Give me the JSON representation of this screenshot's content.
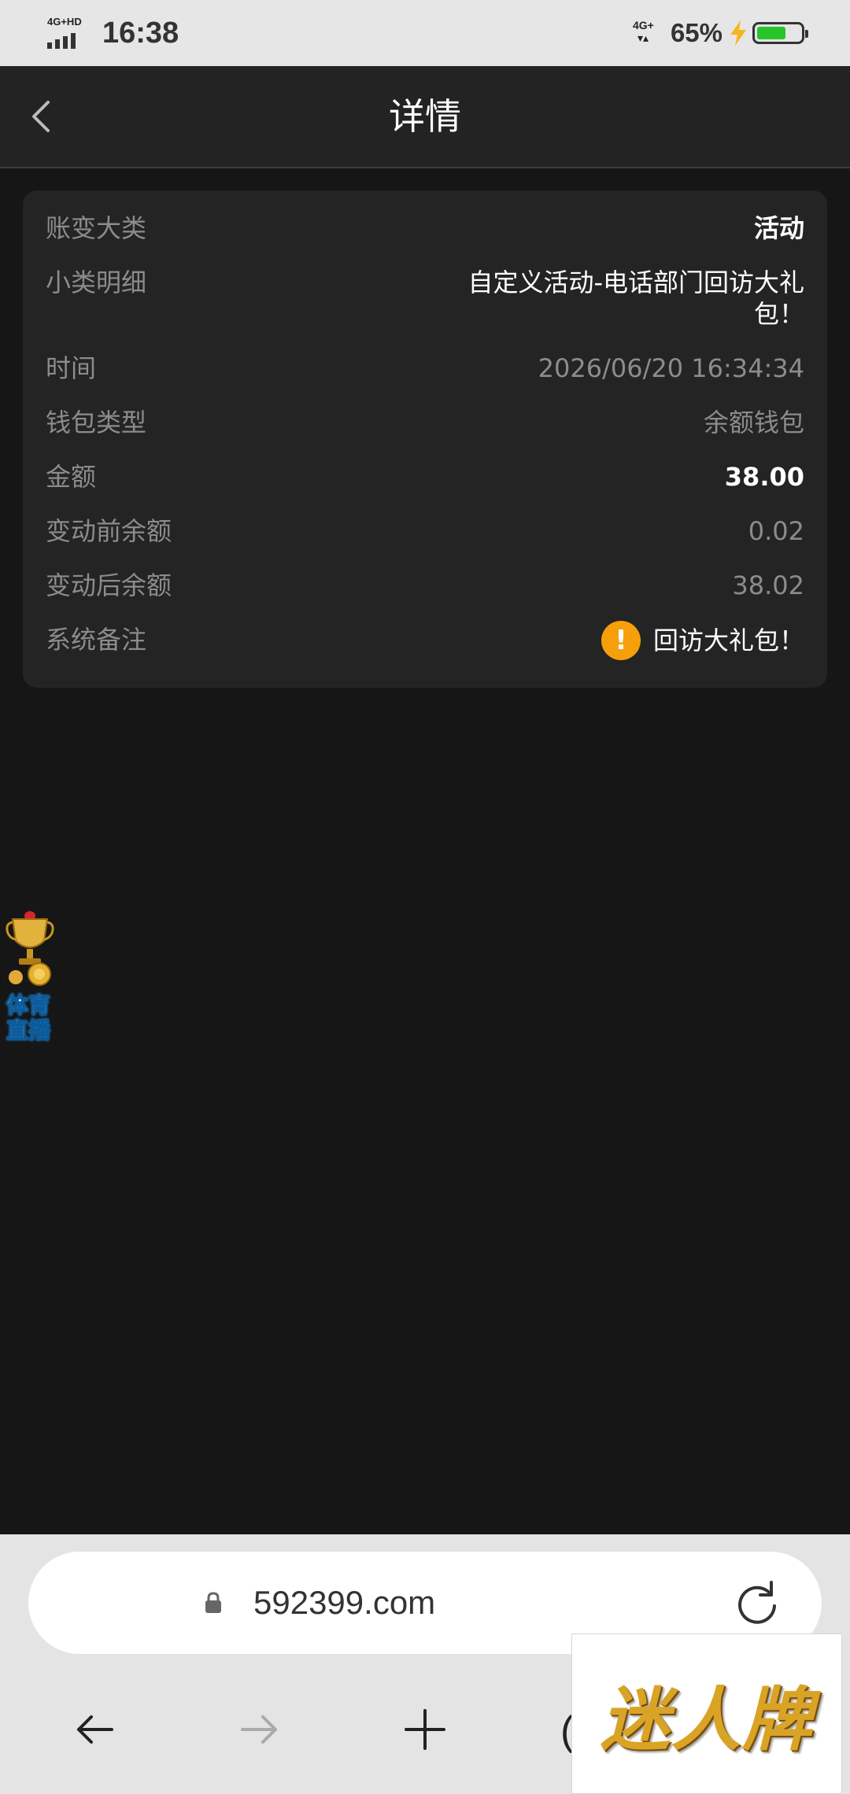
{
  "status_bar": {
    "signal_label": "4G+HD",
    "time": "16:38",
    "network_label": "4G+",
    "battery_percent": "65%",
    "battery_level": 0.65,
    "battery_color": "#27c52a"
  },
  "header": {
    "title": "详情"
  },
  "details": {
    "rows": [
      {
        "label": "账变大类",
        "value": "活动"
      },
      {
        "label": "小类明细",
        "value": "自定义活动-电话部门回访大礼包！"
      },
      {
        "label": "时间",
        "value": "2026/06/20 16:34:34"
      },
      {
        "label": "钱包类型",
        "value": "余额钱包"
      },
      {
        "label": "金额",
        "value": "38.00"
      },
      {
        "label": "变动前余额",
        "value": "0.02"
      },
      {
        "label": "变动后余额",
        "value": "38.02"
      },
      {
        "label": "系统备注",
        "value": "回访大礼包！"
      }
    ],
    "note_icon_glyph": "!",
    "note_icon_color": "#f5a00a"
  },
  "float_widget": {
    "label_line1": "体育",
    "label_line2": "直播"
  },
  "browser": {
    "url": "592399.com",
    "partial_button_glyph": "("
  },
  "ad": {
    "text": "迷人牌"
  }
}
